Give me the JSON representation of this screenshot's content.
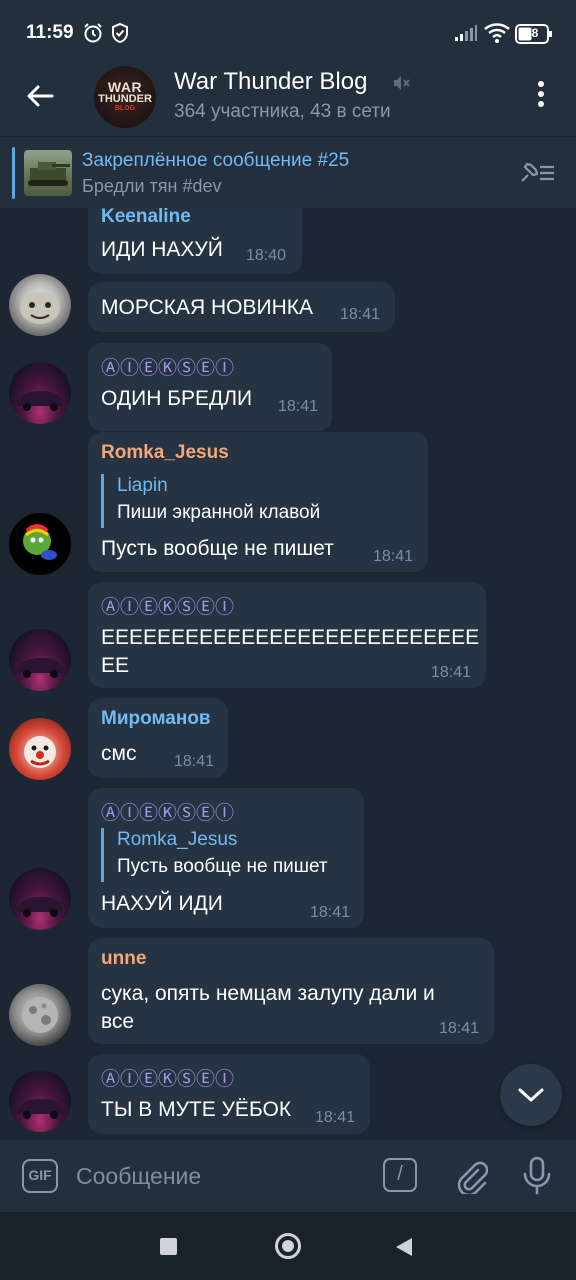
{
  "status_bar": {
    "time": "11:59",
    "battery": "48",
    "icons": [
      "alarm-icon",
      "shield-check-icon",
      "signal-icon",
      "wifi-icon",
      "battery-icon"
    ]
  },
  "header": {
    "title": "War Thunder Blog",
    "subtitle": "364 участника, 43 в сети",
    "avatar_text_1": "WAR",
    "avatar_text_2": "THUNDER",
    "avatar_text_3": "BLOG",
    "muted": true
  },
  "pinned": {
    "title": "Закреплённое сообщение #25",
    "text": "Бредли тян  #dev"
  },
  "colors": {
    "accent": "#5ca8e4",
    "bubble": "#253342",
    "background": "#1d2733",
    "name_blue": "#71baf2",
    "name_orange": "#f4a777",
    "name_purple": "#a695e7"
  },
  "messages": [
    {
      "sender": "Keenaline",
      "text": "ИДИ НАХУЙ",
      "time": "18:40"
    },
    {
      "sender": "",
      "text": "МОРСКАЯ НОВИНКА",
      "time": "18:41"
    },
    {
      "sender": "ⒶⒾⒺⓀⓈⒺⒾ",
      "text": "ОДИН БРЕДЛИ",
      "time": "18:41"
    },
    {
      "sender": "Romka_Jesus",
      "reply_name": "Liapin",
      "reply_text": "Пиши экранной клавой",
      "text": "Пусть вообще не пишет",
      "time": "18:41"
    },
    {
      "sender": "ⒶⒾⒺⓀⓈⒺⒾ",
      "text_line1": "ЕЕЕЕЕЕЕЕЕЕЕЕЕЕЕЕЕЕЕЕЕЕЕЕЕЕЕ",
      "text_line2": "ЕЕ",
      "time": "18:41"
    },
    {
      "sender": "Мироманов",
      "text": "смс",
      "time": "18:41"
    },
    {
      "sender": "ⒶⒾⒺⓀⓈⒺⒾ",
      "reply_name": "Romka_Jesus",
      "reply_text": "Пусть вообще не пишет",
      "text": "НАХУЙ ИДИ",
      "time": "18:41"
    },
    {
      "sender": "unne",
      "text_line1": "сука, опять немцам залупу дали и",
      "text_line2": "все",
      "time": "18:41"
    },
    {
      "sender": "ⒶⒾⒺⓀⓈⒺⒾ",
      "text": "ТЫ В МУТЕ УЁБОК",
      "time": "18:41"
    }
  ],
  "input": {
    "placeholder": "Сообщение",
    "gif_label": "GIF",
    "command_label": "/"
  }
}
